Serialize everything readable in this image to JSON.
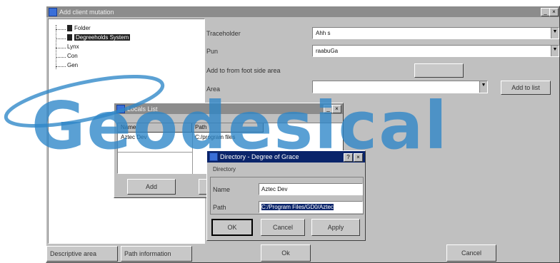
{
  "main_window": {
    "title": "Add client mutation",
    "tree_items": [
      "Folder",
      "Degreeholds System",
      "Lynx",
      "Con",
      "Gen"
    ],
    "fields": [
      {
        "label": "Traceholder",
        "value": "Ahh s"
      },
      {
        "label": "Pun",
        "value": "raabuGa"
      },
      {
        "label": "Add to from foot side area",
        "value": ""
      },
      {
        "label": "Area",
        "value": ""
      }
    ],
    "add_button": "Add to list",
    "bottom_tabs": [
      "Descriptive area",
      "Path information"
    ],
    "bottom_buttons": [
      "Ok",
      "Cancel"
    ]
  },
  "locals_dialog": {
    "title": "Locals List",
    "columns": [
      "Name",
      "Path"
    ],
    "row": {
      "name": "Aztec Dev",
      "path": "C:/program files"
    },
    "add_button": "Add"
  },
  "directory_dialog": {
    "title": "Directory - Degree of Grace",
    "group_label": "Directory",
    "name_label": "Name",
    "name_value": "Aztec Dev",
    "path_label": "Path",
    "path_value": "C:/Program Files/GD0/Aztec",
    "buttons": [
      "OK",
      "Cancel",
      "Apply"
    ]
  },
  "watermark": {
    "text": "Geodesical",
    "color": "#2d86c8"
  }
}
